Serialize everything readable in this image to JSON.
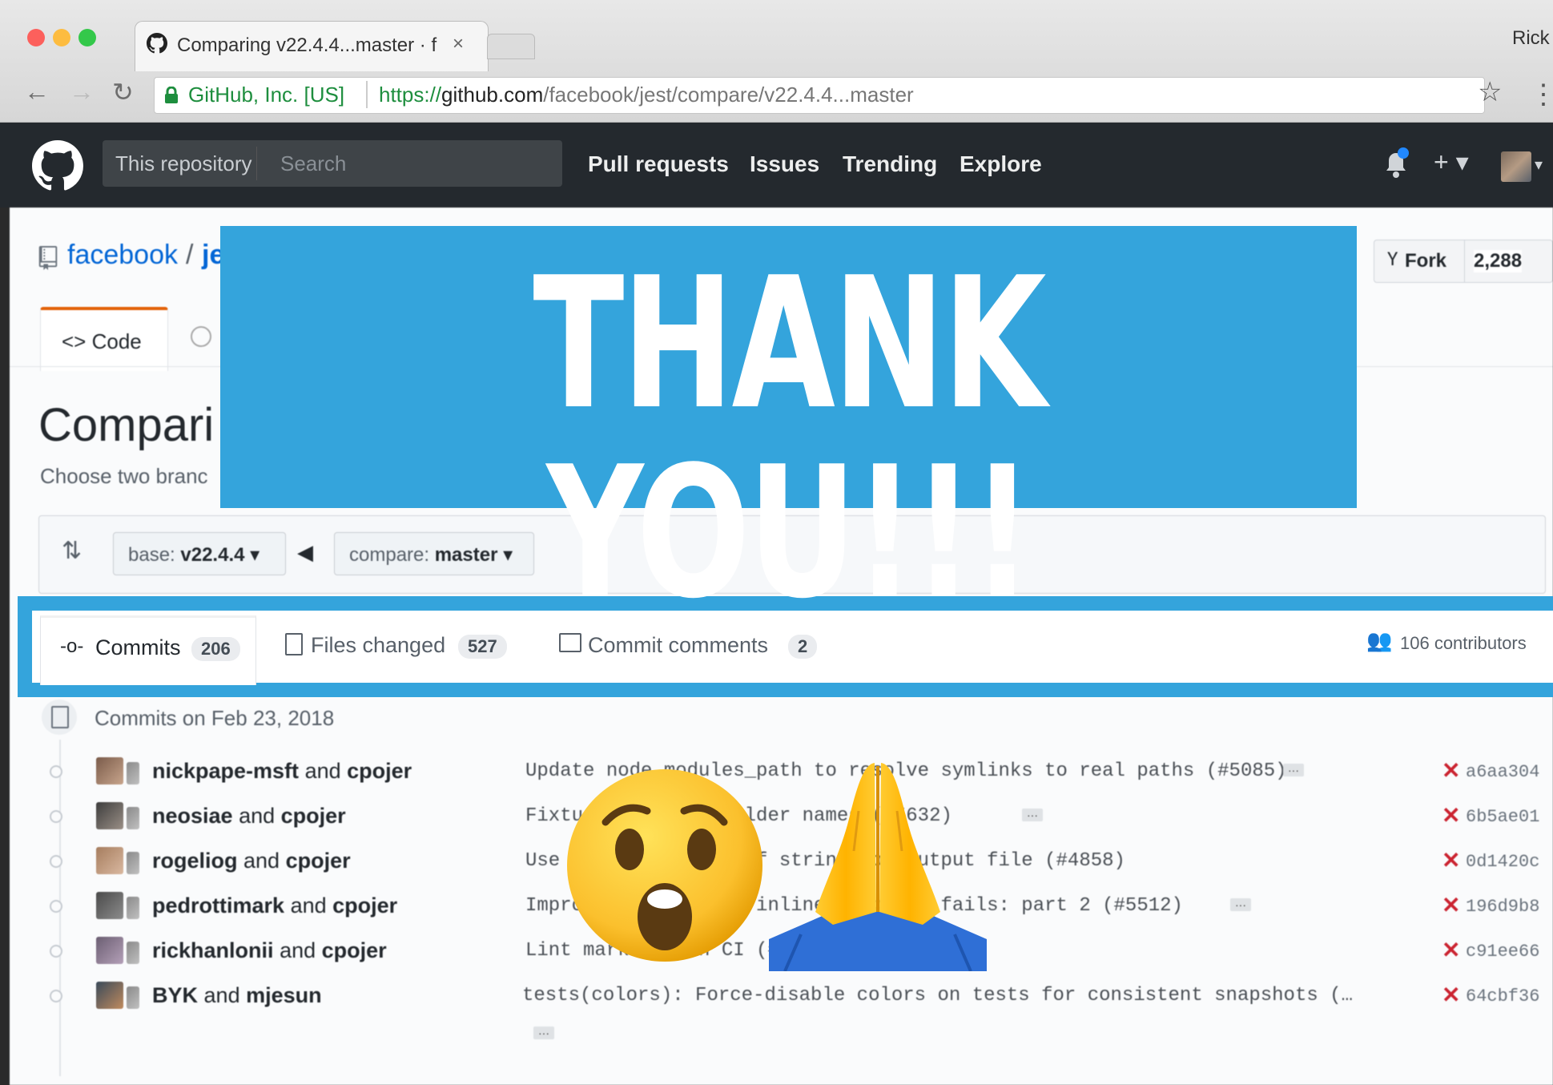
{
  "browser": {
    "tab_title": "Comparing v22.4.4...master · f",
    "tab_close": "×",
    "user_name": "Rick",
    "origin_label": "GitHub, Inc. [US]",
    "url_scheme": "https://",
    "url_host": "github.com",
    "url_path": "/facebook/jest/compare/v22.4.4...master",
    "star_glyph": "☆",
    "menu_glyph": "⋮"
  },
  "github_header": {
    "scope_label": "This repository",
    "search_placeholder": "Search",
    "nav": [
      "Pull requests",
      "Issues",
      "Trending",
      "Explore"
    ],
    "plus_glyph": "+ ▾"
  },
  "repo": {
    "owner": "facebook",
    "separator": "/",
    "name_visible": "je",
    "fork_label": "Fork",
    "fork_count": "2,288"
  },
  "repo_tabs": {
    "code_label": "<> Code"
  },
  "compare": {
    "title_visible": "Compari",
    "subtitle_visible": "Choose two branc",
    "base_label": "base: ",
    "base_value": "v22.4.4",
    "compare_label": "compare: ",
    "compare_value": "master",
    "arrow": "◀"
  },
  "tabs": {
    "commits_label": "Commits",
    "commits_count": "206",
    "files_label": "Files changed",
    "files_count": "527",
    "comments_label": "Commit comments",
    "comments_count": "2",
    "contributors": "106 contributors"
  },
  "commit_group": {
    "heading": "Commits on Feb 23, 2018",
    "commits": [
      {
        "author": "nickpape-msft",
        "coauthor": "cpojer",
        "message": "Update node_modules_path to resolve symlinks to real paths (#5085)",
        "sha": "a6aa304",
        "has_ellipsis": true
      },
      {
        "author": "neosiae",
        "coauthor": "cpojer",
        "message": "Fixtures: rename folder names (#5632)",
        "sha": "6b5ae01",
        "has_ellipsis": true
      },
      {
        "author": "rogeliog",
        "coauthor": "cpojer",
        "message": "Use stream instead of string for output file (#4858)",
        "sha": "0d1420c",
        "has_ellipsis": false
      },
      {
        "author": "pedrottimark",
        "coauthor": "cpojer",
        "message": "Improve output when inline snapshot fails: part 2 (#5512)",
        "sha": "196d9b8",
        "has_ellipsis": true
      },
      {
        "author": "rickhanlonii",
        "coauthor": "cpojer",
        "message": "Lint markdown on CI (#5631)",
        "sha": "c91ee66",
        "has_ellipsis": false
      },
      {
        "author": "BYK",
        "coauthor": "mjesun",
        "message": "tests(colors): Force-disable colors on tests for consistent snapshots (…",
        "sha": "64cbf36",
        "has_ellipsis": true
      }
    ],
    "joiner": "and"
  },
  "banner": {
    "text": "THANK YOU!!!"
  },
  "colors": {
    "banner_blue": "#34a4dc",
    "github_dark": "#24292e",
    "fail_red": "#cb2431"
  }
}
